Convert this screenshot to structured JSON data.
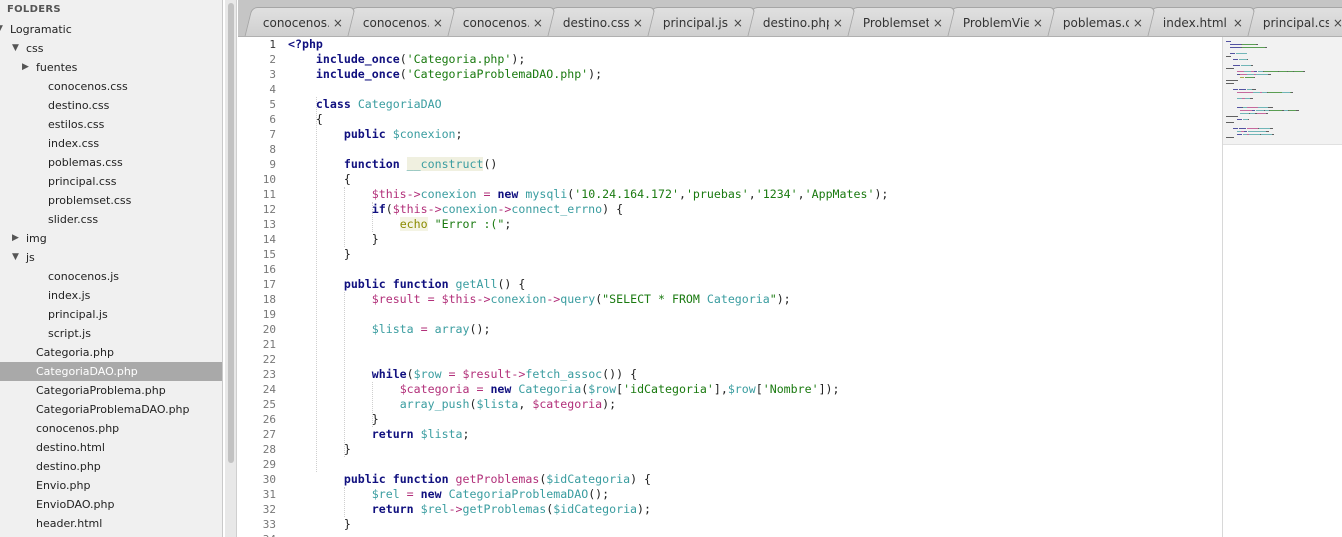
{
  "sidebar": {
    "header": "FOLDERS",
    "items": [
      {
        "label": "Logramatic",
        "depth": 0,
        "arrow": "down"
      },
      {
        "label": "css",
        "depth": 1,
        "arrow": "down"
      },
      {
        "label": "fuentes",
        "depth": 2,
        "arrow": "right"
      },
      {
        "label": "conocenos.css",
        "depth": 3
      },
      {
        "label": "destino.css",
        "depth": 3
      },
      {
        "label": "estilos.css",
        "depth": 3
      },
      {
        "label": "index.css",
        "depth": 3
      },
      {
        "label": "poblemas.css",
        "depth": 3
      },
      {
        "label": "principal.css",
        "depth": 3
      },
      {
        "label": "problemset.css",
        "depth": 3
      },
      {
        "label": "slider.css",
        "depth": 3
      },
      {
        "label": "img",
        "depth": 1,
        "arrow": "right"
      },
      {
        "label": "js",
        "depth": 1,
        "arrow": "down"
      },
      {
        "label": "conocenos.js",
        "depth": 3
      },
      {
        "label": "index.js",
        "depth": 3
      },
      {
        "label": "principal.js",
        "depth": 3
      },
      {
        "label": "script.js",
        "depth": 3
      },
      {
        "label": "Categoria.php",
        "depth": 2
      },
      {
        "label": "CategoriaDAO.php",
        "depth": 2,
        "selected": true
      },
      {
        "label": "CategoriaProblema.php",
        "depth": 2
      },
      {
        "label": "CategoriaProblemaDAO.php",
        "depth": 2
      },
      {
        "label": "conocenos.php",
        "depth": 2
      },
      {
        "label": "destino.html",
        "depth": 2
      },
      {
        "label": "destino.php",
        "depth": 2
      },
      {
        "label": "Envio.php",
        "depth": 2
      },
      {
        "label": "EnvioDAO.php",
        "depth": 2
      },
      {
        "label": "header.html",
        "depth": 2
      }
    ]
  },
  "tabs": [
    {
      "label": "conocenos.p",
      "close": "×"
    },
    {
      "label": "conocenos.c",
      "close": "×"
    },
    {
      "label": "conocenos.js",
      "close": "×"
    },
    {
      "label": "destino.css",
      "close": "×"
    },
    {
      "label": "principal.js",
      "close": "×"
    },
    {
      "label": "destino.php",
      "close": "×"
    },
    {
      "label": "Problemset.p",
      "close": "×"
    },
    {
      "label": "ProblemView",
      "close": "×"
    },
    {
      "label": "poblemas.css",
      "close": "×"
    },
    {
      "label": "index.html",
      "close": "×"
    },
    {
      "label": "principal.css",
      "close": "×"
    }
  ],
  "editor": {
    "current_line": 1,
    "lines": [
      [
        [
          "<?php",
          "k"
        ]
      ],
      [
        [
          "    ",
          ""
        ],
        [
          "include_once",
          "k"
        ],
        [
          "(",
          "p"
        ],
        [
          "'Categoria.php'",
          "s"
        ],
        [
          ");",
          "p"
        ]
      ],
      [
        [
          "    ",
          ""
        ],
        [
          "include_once",
          "k"
        ],
        [
          "(",
          "p"
        ],
        [
          "'CategoriaProblemaDAO.php'",
          "s"
        ],
        [
          ");",
          "p"
        ]
      ],
      [],
      [
        [
          "    ",
          ""
        ],
        [
          "class",
          "k"
        ],
        [
          " ",
          ""
        ],
        [
          "CategoriaDAO",
          "c"
        ]
      ],
      [
        [
          "    {",
          "p"
        ]
      ],
      [
        [
          "        ",
          ""
        ],
        [
          "public",
          "k"
        ],
        [
          " ",
          ""
        ],
        [
          "$conexion",
          "v"
        ],
        [
          ";",
          "p"
        ]
      ],
      [],
      [
        [
          "        ",
          ""
        ],
        [
          "function",
          "k"
        ],
        [
          " ",
          ""
        ],
        [
          "__construct",
          "fh"
        ],
        [
          "()",
          "p"
        ]
      ],
      [
        [
          "        {",
          "p"
        ]
      ],
      [
        [
          "            ",
          ""
        ],
        [
          "$this",
          "v2"
        ],
        [
          "->",
          "op"
        ],
        [
          "conexion",
          "v"
        ],
        [
          " = ",
          "op"
        ],
        [
          "new",
          "k"
        ],
        [
          " ",
          ""
        ],
        [
          "mysqli",
          "c"
        ],
        [
          "(",
          "p"
        ],
        [
          "'10.24.164.172'",
          "s"
        ],
        [
          ",",
          "p"
        ],
        [
          "'pruebas'",
          "s"
        ],
        [
          ",",
          "p"
        ],
        [
          "'1234'",
          "s"
        ],
        [
          ",",
          "p"
        ],
        [
          "'AppMates'",
          "s"
        ],
        [
          ");",
          "p"
        ]
      ],
      [
        [
          "            ",
          ""
        ],
        [
          "if",
          "k"
        ],
        [
          "(",
          "p"
        ],
        [
          "$this",
          "v2"
        ],
        [
          "->",
          "op"
        ],
        [
          "conexion",
          "v"
        ],
        [
          "->",
          "op"
        ],
        [
          "connect_errno",
          "f"
        ],
        [
          ") {",
          "p"
        ]
      ],
      [
        [
          "                ",
          ""
        ],
        [
          "echo",
          "eh"
        ],
        [
          " ",
          ""
        ],
        [
          "\"Error :(\"",
          "s"
        ],
        [
          ";",
          "p"
        ]
      ],
      [
        [
          "            }",
          "p"
        ]
      ],
      [
        [
          "        }",
          "p"
        ]
      ],
      [],
      [
        [
          "        ",
          ""
        ],
        [
          "public",
          "k"
        ],
        [
          " ",
          ""
        ],
        [
          "function",
          "k"
        ],
        [
          " ",
          ""
        ],
        [
          "getAll",
          "f"
        ],
        [
          "() {",
          "p"
        ]
      ],
      [
        [
          "            ",
          ""
        ],
        [
          "$result",
          "v2"
        ],
        [
          " = ",
          "op"
        ],
        [
          "$this",
          "v2"
        ],
        [
          "->",
          "op"
        ],
        [
          "conexion",
          "v"
        ],
        [
          "->",
          "op"
        ],
        [
          "query",
          "f"
        ],
        [
          "(",
          "p"
        ],
        [
          "\"SELECT * FROM ",
          "s"
        ],
        [
          "Categoria",
          "c"
        ],
        [
          "\"",
          "s"
        ],
        [
          ");",
          "p"
        ]
      ],
      [],
      [
        [
          "            ",
          ""
        ],
        [
          "$lista",
          "v"
        ],
        [
          " = ",
          "op"
        ],
        [
          "array",
          "f"
        ],
        [
          "();",
          "p"
        ]
      ],
      [],
      [],
      [
        [
          "            ",
          ""
        ],
        [
          "while",
          "k"
        ],
        [
          "(",
          "p"
        ],
        [
          "$row",
          "v"
        ],
        [
          " = ",
          "op"
        ],
        [
          "$result",
          "v2"
        ],
        [
          "->",
          "op"
        ],
        [
          "fetch_assoc",
          "f"
        ],
        [
          "()) {",
          "p"
        ]
      ],
      [
        [
          "                ",
          ""
        ],
        [
          "$categoria",
          "v2"
        ],
        [
          " = ",
          "op"
        ],
        [
          "new",
          "k"
        ],
        [
          " ",
          ""
        ],
        [
          "Categoria",
          "c"
        ],
        [
          "(",
          "p"
        ],
        [
          "$row",
          "v"
        ],
        [
          "[",
          "p"
        ],
        [
          "'idCategoria'",
          "s"
        ],
        [
          "],",
          "p"
        ],
        [
          "$row",
          "v"
        ],
        [
          "[",
          "p"
        ],
        [
          "'Nombre'",
          "s"
        ],
        [
          "]);",
          "p"
        ]
      ],
      [
        [
          "                ",
          ""
        ],
        [
          "array_push",
          "f"
        ],
        [
          "(",
          "p"
        ],
        [
          "$lista",
          "v"
        ],
        [
          ", ",
          "p"
        ],
        [
          "$categoria",
          "v2"
        ],
        [
          ");",
          "p"
        ]
      ],
      [
        [
          "            }",
          "p"
        ]
      ],
      [
        [
          "            ",
          ""
        ],
        [
          "return",
          "k"
        ],
        [
          " ",
          ""
        ],
        [
          "$lista",
          "v"
        ],
        [
          ";",
          "p"
        ]
      ],
      [
        [
          "        }",
          "p"
        ]
      ],
      [],
      [
        [
          "        ",
          ""
        ],
        [
          "public",
          "k"
        ],
        [
          " ",
          ""
        ],
        [
          "function",
          "k"
        ],
        [
          " ",
          ""
        ],
        [
          "getProblemas",
          "f2"
        ],
        [
          "(",
          "p"
        ],
        [
          "$idCategoria",
          "v"
        ],
        [
          ") {",
          "p"
        ]
      ],
      [
        [
          "            ",
          ""
        ],
        [
          "$rel",
          "v"
        ],
        [
          " = ",
          "op"
        ],
        [
          "new",
          "k"
        ],
        [
          " ",
          ""
        ],
        [
          "CategoriaProblemaDAO",
          "c"
        ],
        [
          "();",
          "p"
        ]
      ],
      [
        [
          "            ",
          ""
        ],
        [
          "return",
          "k"
        ],
        [
          " ",
          ""
        ],
        [
          "$rel",
          "v"
        ],
        [
          "->",
          "op"
        ],
        [
          "getProblemas",
          "f"
        ],
        [
          "(",
          "p"
        ],
        [
          "$idCategoria",
          "v"
        ],
        [
          ");",
          "p"
        ]
      ],
      [
        [
          "        }",
          "p"
        ]
      ],
      []
    ]
  },
  "colors": {
    "k": "#10107f",
    "s": "#1a7a10",
    "v": "#3a9da0",
    "v2": "#b2307a",
    "c": "#3a9da0",
    "f": "#3a9da0",
    "f2": "#b2307a",
    "fh": "#3a9da0",
    "eh": "#8a8a00",
    "op": "#b2307a",
    "p": "#222222"
  }
}
